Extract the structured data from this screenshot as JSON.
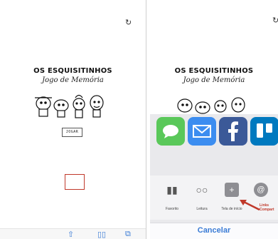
{
  "left_panel": {
    "refresh_icon": "refresh-icon",
    "game_title": "OS ESQUISITINHOS",
    "game_subtitle": "Jogo de Memória",
    "play_button": "JOGAR",
    "toolbar_icons": [
      "share-icon",
      "book-icon",
      "tabs-icon"
    ]
  },
  "right_panel": {
    "refresh_icon": "refresh-icon",
    "game_title": "OS ESQUISITINHOS",
    "game_subtitle": "Jogo de Memória",
    "share_apps": [
      {
        "icon": "messages-icon",
        "color": "#5ac85a"
      },
      {
        "icon": "mail-icon",
        "color": "#3c8df0"
      },
      {
        "icon": "facebook-icon",
        "color": "#3b5998"
      },
      {
        "icon": "trello-icon",
        "color": "#0079bf"
      }
    ],
    "actions": [
      {
        "icon": "book-icon",
        "label": "Favorito"
      },
      {
        "icon": "glasses-icon",
        "label": "Leitura"
      },
      {
        "icon": "plus-square-icon",
        "label": "Tela de início"
      },
      {
        "icon": "at-icon",
        "label": ""
      }
    ],
    "annotation": "Links Compart",
    "cancel": "Cancelar"
  }
}
